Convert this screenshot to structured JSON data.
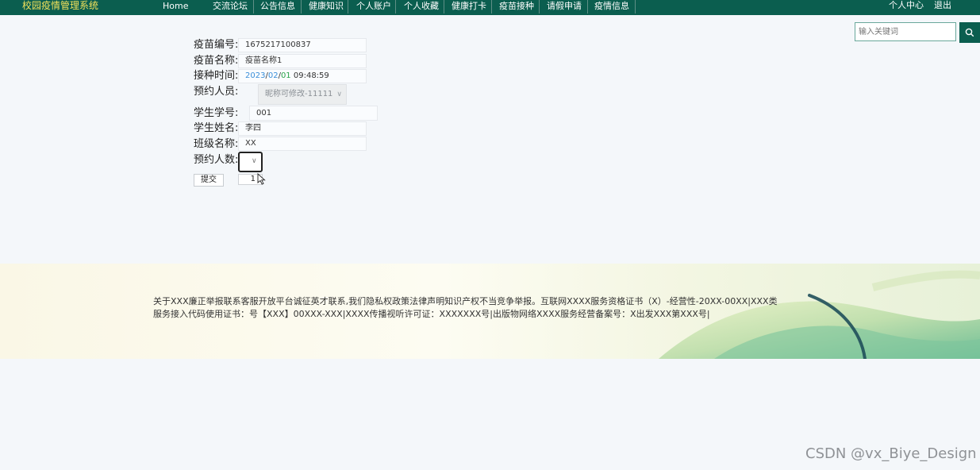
{
  "header": {
    "brand": "校园疫情管理系统",
    "nav": [
      "Home",
      "交流论坛",
      "公告信息",
      "健康知识",
      "个人账户",
      "个人收藏",
      "健康打卡",
      "疫苗接种",
      "请假申请",
      "疫情信息"
    ],
    "user_center": "个人中心",
    "logout": "退出"
  },
  "search": {
    "placeholder": "输入关键词",
    "icon": "search-icon"
  },
  "form": {
    "vaccine_no_label": "疫苗编号:",
    "vaccine_no": "1675217100837",
    "vaccine_name_label": "疫苗名称:",
    "vaccine_name": "疫苗名称1",
    "time_label": "接种时间:",
    "time_year": "2023",
    "time_month": "02",
    "time_day": "01",
    "time_clock": "09:48:59",
    "person_label": "预约人员:",
    "person_value": "昵称可修改-11111",
    "student_no_label": "学生学号:",
    "student_no": "001",
    "student_name_label": "学生姓名:",
    "student_name": "李四",
    "class_label": "班级名称:",
    "class_value": "XX",
    "count_label": "预约人数:",
    "count_option": "1",
    "submit": "提交"
  },
  "footer": {
    "text": "关于XXX廉正举报联系客服开放平台诚征英才联系,我们隐私权政策法律声明知识产权不当竞争举报。互联网XXXX服务资格证书（X）-经营性-20XX-00XX|XXX类服务接入代码使用证书：号【XXX】00XXX-XXX|XXXX传播视听许可证：XXXXXXX号|出版物网络XXXX服务经营备案号：X出发XXX第XXX号|"
  },
  "watermark": "CSDN @vx_Biye_Design",
  "colors": {
    "nav_bg": "#0b5e4f",
    "brand_text": "#f1e15b",
    "page_bg": "#f4f7fa"
  }
}
